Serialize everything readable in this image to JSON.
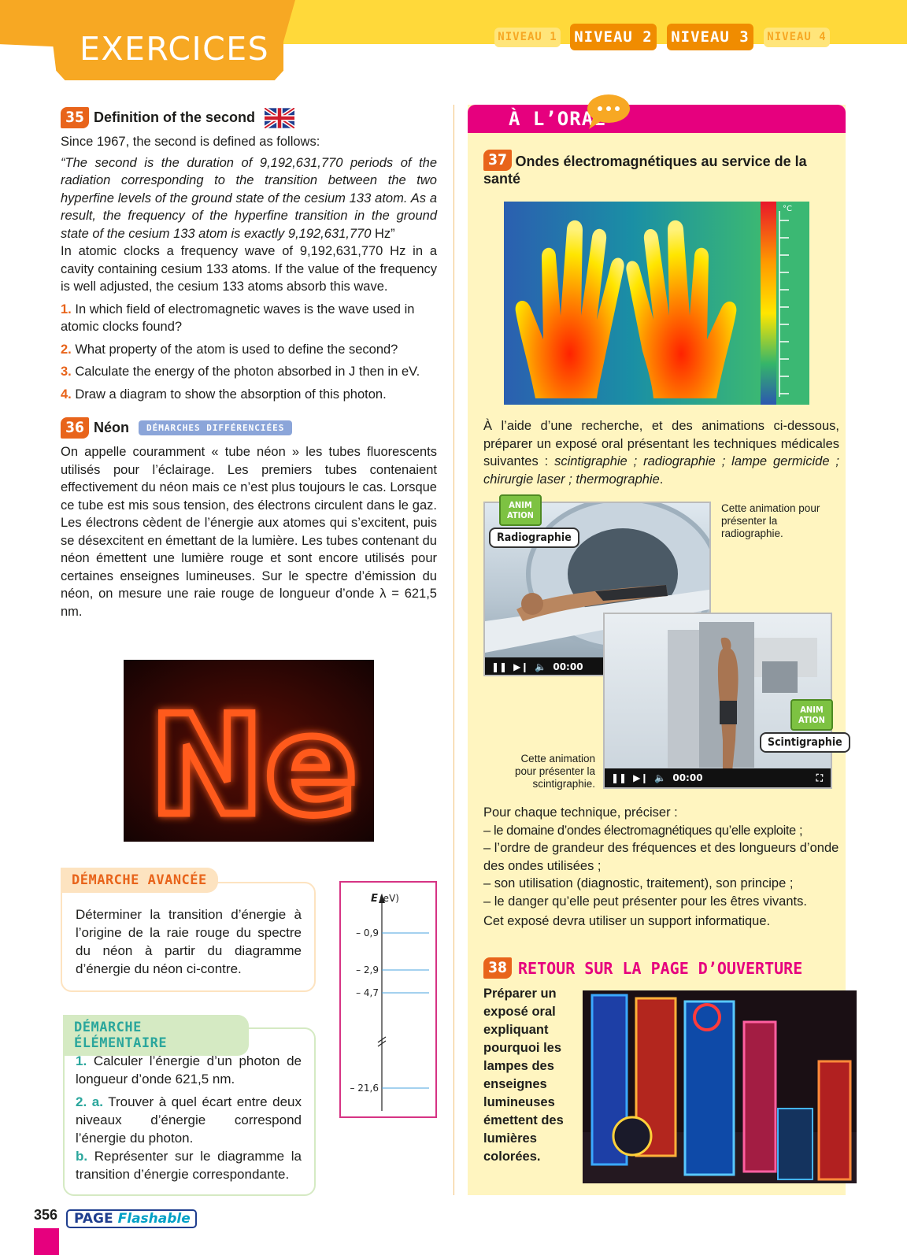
{
  "header": {
    "section_title": "EXERCICES",
    "levels": [
      {
        "label": "NIVEAU 1",
        "active": false
      },
      {
        "label": "NIVEAU 2",
        "active": true
      },
      {
        "label": "NIVEAU 3",
        "active": true
      },
      {
        "label": "NIVEAU 4",
        "active": false
      }
    ]
  },
  "ex35": {
    "number": "35",
    "title": "Definition of the second",
    "flag_icon": "uk-flag-icon",
    "intro": "Since 1967, the second is defined as follows:",
    "quote": "“The second is the duration of 9,192,631,770 periods of the radiation corresponding to the transition between the two hyperfine levels of the ground state of the cesium 133 atom. As a result, the frequency of the hyperfine transition in the ground state of the cesium 133 atom is exactly 9,192,631,770",
    "quote_unit": " Hz”",
    "body": "In atomic clocks a frequency wave of 9,192,631,770 Hz in a cavity containing cesium 133 atoms. If the value of the frequency is well adjusted, the cesium 133 atoms absorb this wave.",
    "questions": [
      {
        "n": "1.",
        "text": "In which field of electromagnetic waves is the wave used in atomic clocks found?"
      },
      {
        "n": "2.",
        "text": "What property of the atom is used to define the second?"
      },
      {
        "n": "3.",
        "text": "Calculate the energy of the photon absorbed in J then in eV."
      },
      {
        "n": "4.",
        "text": "Draw a diagram to show the absorption of this photon."
      }
    ]
  },
  "ex36": {
    "number": "36",
    "title": "Néon",
    "badge": "DÉMARCHES DIFFÉRENCIÉES",
    "body": "On appelle couramment « tube néon » les tubes fluorescents utilisés pour l’éclairage. Les premiers tubes contenaient effectivement du néon mais ce n’est plus toujours le cas. Lorsque ce tube est mis sous tension, des électrons circulent dans le gaz. Les électrons cèdent de l’énergie aux atomes qui s’excitent, puis se désexcitent en émettant de la lumière. Les tubes contenant du néon émettent une lumière rouge et sont encore utilisés pour certaines enseignes lumineuses. Sur le spectre d’émission du néon, on mesure une raie rouge de longueur d’onde λ = 621,5 nm.",
    "photo_text": "Ne",
    "advanced": {
      "label": "DÉMARCHE AVANCÉE",
      "text": "Déterminer la transition d’énergie à l’origine de la raie rouge du spectre du néon à partir du diagramme d’énergie du néon ci-contre."
    },
    "elementary": {
      "label": "DÉMARCHE ÉLÉMENTAIRE",
      "q1_n": "1.",
      "q1": " Calculer l’énergie d’un photon de longueur d’onde 621,5 nm.",
      "q2_n": "2. a.",
      "q2": " Trouver à quel écart entre deux niveaux d’énergie correspond l’énergie du photon.",
      "q2b_n": "b.",
      "q2b": " Représenter sur le diagramme la transition d’énergie correspondante."
    },
    "diagram": {
      "axis_symbol": "E",
      "axis_unit": "(eV)",
      "levels": [
        "– 0,9",
        "– 2,9",
        "– 4,7",
        "– 21,6"
      ]
    }
  },
  "oral": {
    "title": "À L’ORAL",
    "bubble_icon": "speech-bubble-icon",
    "ex37": {
      "number": "37",
      "title": "Ondes électromagnétiques au service de la santé",
      "thermo_unit": "°C",
      "instructions_pre": "À l’aide d’une recherche, et des animations ci-dessous, préparer un exposé oral présentant les techniques médicales suivantes : ",
      "instructions_list": "scintigraphie ; radiographie ; lampe germicide ; chirurgie laser ; thermographie",
      "instructions_end": ".",
      "anim1": {
        "badge": "ANIM ATION",
        "label": "Radiographie",
        "time": "00:00",
        "caption": "Cette animation pour présenter la radiographie."
      },
      "anim2": {
        "badge": "ANIM ATION",
        "label": "Scintigraphie",
        "time": "00:00",
        "caption": "Cette animation pour présenter la scintigraphie."
      },
      "precise_intro": "Pour chaque technique, préciser :",
      "precise_items": [
        "– le domaine d’ondes électromagnétiques qu’elle exploite ;",
        "– l’ordre de grandeur des fréquences et des longueurs d’onde des ondes utilisées ;",
        "– son utilisation (diagnostic, traitement), son principe ;",
        "– le danger qu’elle peut présenter pour les êtres vivants."
      ],
      "closing": "Cet exposé devra utiliser un support informatique."
    },
    "ex38": {
      "number": "38",
      "title": "RETOUR SUR LA PAGE D’OUVERTURE",
      "text": "Préparer un exposé oral expliquant pourquoi les lampes des enseignes lumineuses émettent des lumières colorées."
    }
  },
  "footer": {
    "page_number": "356",
    "logo_page": "PAGE",
    "logo_flash": "Flashable"
  },
  "colors": {
    "accent_orange": "#e8641b",
    "header_yellow": "#ffd93a",
    "tab_orange": "#f7a823",
    "oral_pink": "#e6007e",
    "oral_bg": "#fff5c0",
    "elementary_green": "#2aa69c"
  }
}
